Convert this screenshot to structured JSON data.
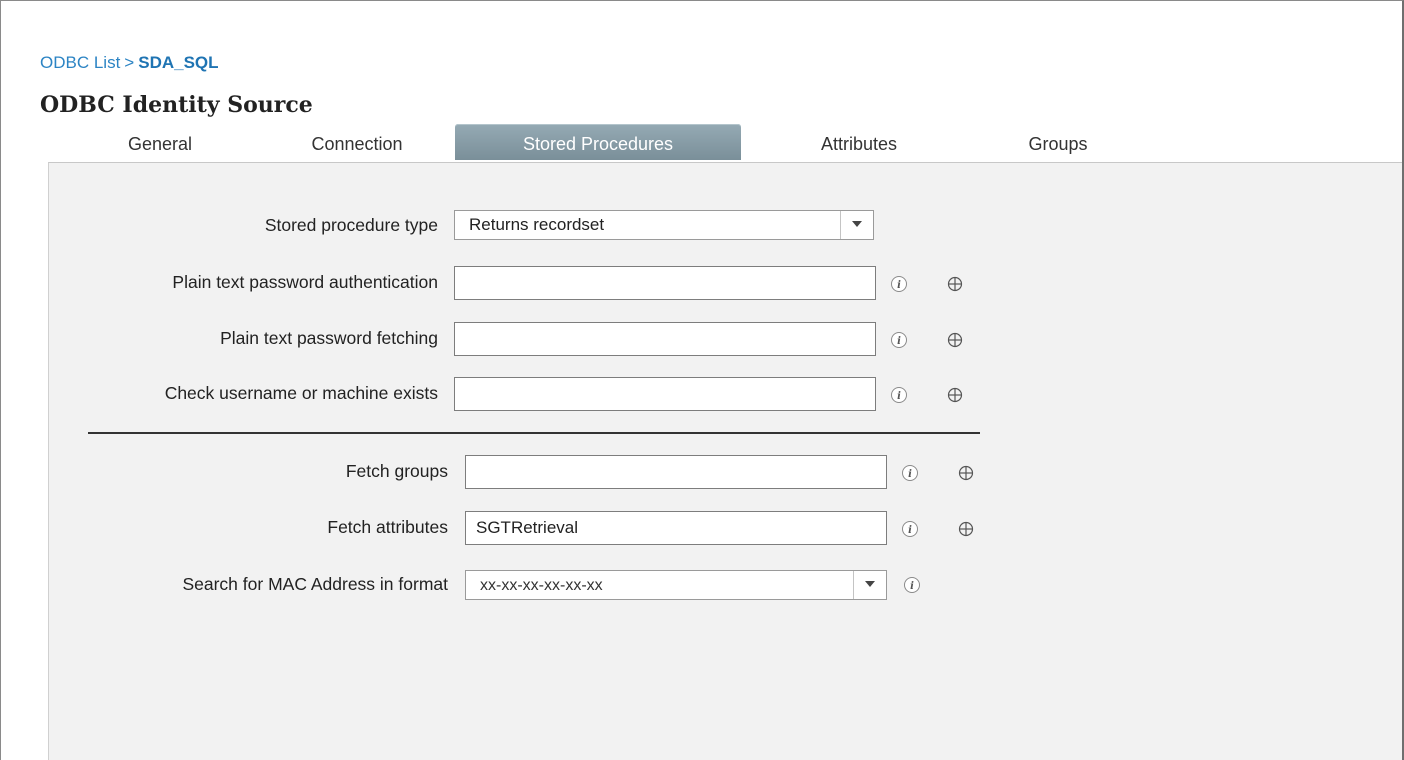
{
  "breadcrumb": {
    "parent": "ODBC List",
    "separator": ">",
    "current": "SDA_SQL"
  },
  "page_title": "ODBC Identity Source",
  "tabs": [
    {
      "label": "General",
      "active": false
    },
    {
      "label": "Connection",
      "active": false
    },
    {
      "label": "Stored Procedures",
      "active": true
    },
    {
      "label": "Attributes",
      "active": false
    },
    {
      "label": "Groups",
      "active": false
    }
  ],
  "form": {
    "stored_procedure_type": {
      "label": "Stored procedure type",
      "selected": "Returns recordset"
    },
    "plain_text_password_auth": {
      "label": "Plain text password authentication",
      "value": ""
    },
    "plain_text_password_fetching": {
      "label": "Plain text password fetching",
      "value": ""
    },
    "check_username_exists": {
      "label": "Check username or machine exists",
      "value": ""
    },
    "fetch_groups": {
      "label": "Fetch groups",
      "value": ""
    },
    "fetch_attributes": {
      "label": "Fetch attributes",
      "value": "SGTRetrieval"
    },
    "mac_address_format": {
      "label": "Search for MAC Address in format",
      "selected": "xx-xx-xx-xx-xx-xx"
    }
  },
  "icons": {
    "info": "info-icon",
    "target": "crosshair-icon",
    "dropdown": "chevron-down-icon"
  },
  "colors": {
    "link": "#2c84c4",
    "active_tab": "#87a0ab",
    "panel_background": "#f2f2f2"
  }
}
